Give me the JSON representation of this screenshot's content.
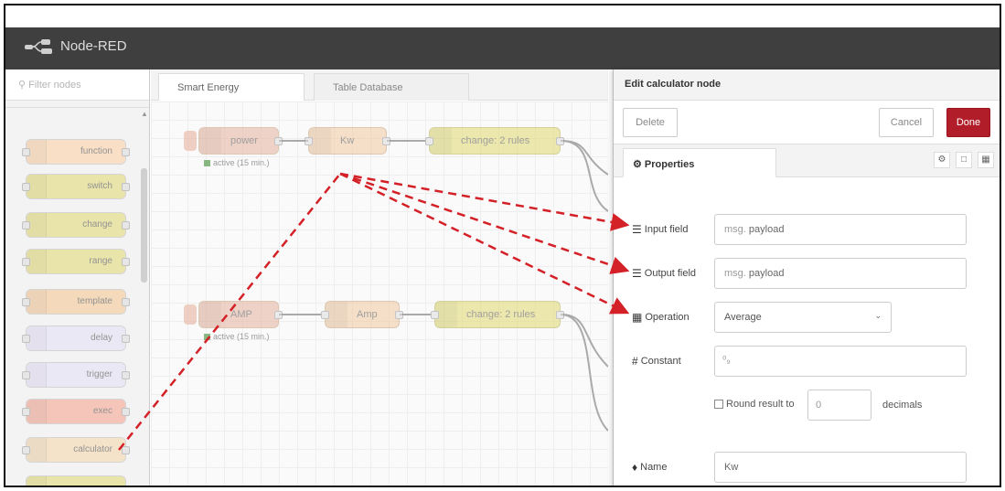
{
  "app": {
    "title": "Node-RED"
  },
  "palette": {
    "filter_placeholder": "Filter nodes",
    "category": "function",
    "nodes": [
      {
        "label": "function",
        "color": "#fdd0a2"
      },
      {
        "label": "switch",
        "color": "#e2d96e"
      },
      {
        "label": "change",
        "color": "#e2d96e"
      },
      {
        "label": "range",
        "color": "#e2d96e"
      },
      {
        "label": "template",
        "color": "#f6c48e"
      },
      {
        "label": "delay",
        "color": "#e6e0f8"
      },
      {
        "label": "trigger",
        "color": "#e6e0f8"
      },
      {
        "label": "exec",
        "color": "#f7a08a"
      },
      {
        "label": "calculator",
        "color": "#f6d6a8"
      }
    ]
  },
  "workspace": {
    "tabs": [
      "Smart Energy",
      "Table Database"
    ],
    "flow1": {
      "inject": "power",
      "status": "active (15 min.)",
      "calc": "Kw",
      "change": "change: 2 rules"
    },
    "flow2": {
      "inject": "AMP",
      "status": "active (15 min.)",
      "calc": "Amp",
      "change": "change: 2 rules"
    }
  },
  "tray": {
    "title": "Edit calculator node",
    "delete_label": "Delete",
    "cancel_label": "Cancel",
    "done_label": "Done",
    "properties_tab": "Properties",
    "fields": {
      "input_label": "Input field",
      "input_prefix": "msg.",
      "input_value": "payload",
      "output_label": "Output field",
      "output_prefix": "msg.",
      "output_value": "payload",
      "operation_label": "Operation",
      "operation_value": "Average",
      "constant_label": "Constant",
      "round_label": "Round result to",
      "round_value": "0",
      "decimals_label": "decimals",
      "name_label": "Name",
      "name_value": "Kw"
    }
  },
  "colors": {
    "header": "#3f3f3f",
    "done": "#b21d2a",
    "annotation": "#d42027"
  }
}
